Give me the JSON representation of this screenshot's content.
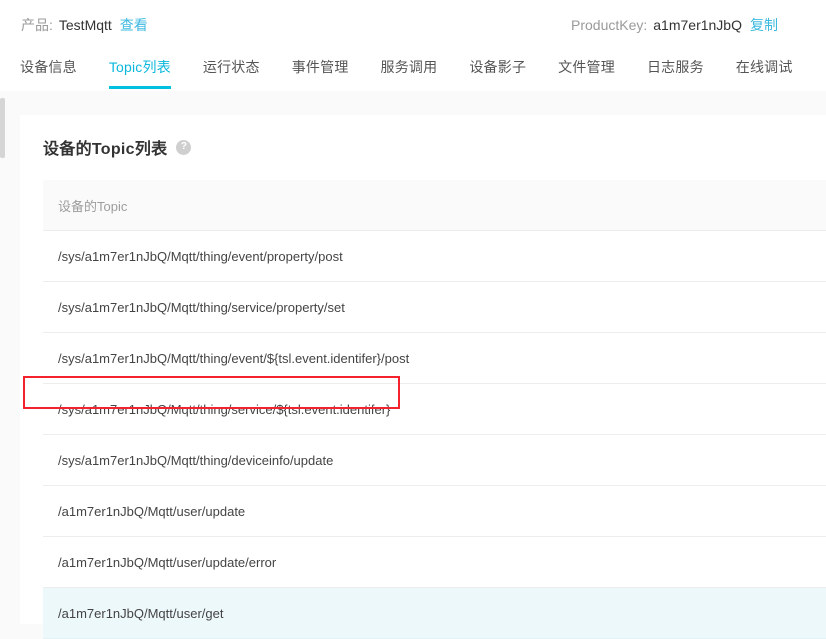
{
  "header": {
    "product_label": "产品:",
    "product_name": "TestMqtt",
    "product_view_link": "查看",
    "productkey_label": "ProductKey:",
    "productkey_value": "a1m7er1nJbQ",
    "productkey_copy_link": "复制"
  },
  "tabs": [
    {
      "label": "设备信息",
      "active": false
    },
    {
      "label": "Topic列表",
      "active": true
    },
    {
      "label": "运行状态",
      "active": false
    },
    {
      "label": "事件管理",
      "active": false
    },
    {
      "label": "服务调用",
      "active": false
    },
    {
      "label": "设备影子",
      "active": false
    },
    {
      "label": "文件管理",
      "active": false
    },
    {
      "label": "日志服务",
      "active": false
    },
    {
      "label": "在线调试",
      "active": false
    }
  ],
  "card": {
    "title": "设备的Topic列表",
    "help_icon_glyph": "?"
  },
  "table": {
    "columns": [
      "设备的Topic"
    ],
    "rows": [
      {
        "topic": "/sys/a1m7er1nJbQ/Mqtt/thing/event/property/post",
        "hovered": false
      },
      {
        "topic": "/sys/a1m7er1nJbQ/Mqtt/thing/service/property/set",
        "hovered": false
      },
      {
        "topic": "/sys/a1m7er1nJbQ/Mqtt/thing/event/${tsl.event.identifer}/post",
        "hovered": false
      },
      {
        "topic": "/sys/a1m7er1nJbQ/Mqtt/thing/service/${tsl.event.identifer}",
        "hovered": false
      },
      {
        "topic": "/sys/a1m7er1nJbQ/Mqtt/thing/deviceinfo/update",
        "hovered": false
      },
      {
        "topic": "/a1m7er1nJbQ/Mqtt/user/update",
        "hovered": false
      },
      {
        "topic": "/a1m7er1nJbQ/Mqtt/user/update/error",
        "hovered": false
      },
      {
        "topic": "/a1m7er1nJbQ/Mqtt/user/get",
        "hovered": true
      }
    ]
  },
  "annotation": {
    "highlight_color": "#f5222d",
    "highlighted_row_index": 1
  },
  "colors": {
    "accent": "#00c0df",
    "link": "#3db8e0",
    "page_background": "#fafafa",
    "row_hover": "#edf8fb"
  }
}
